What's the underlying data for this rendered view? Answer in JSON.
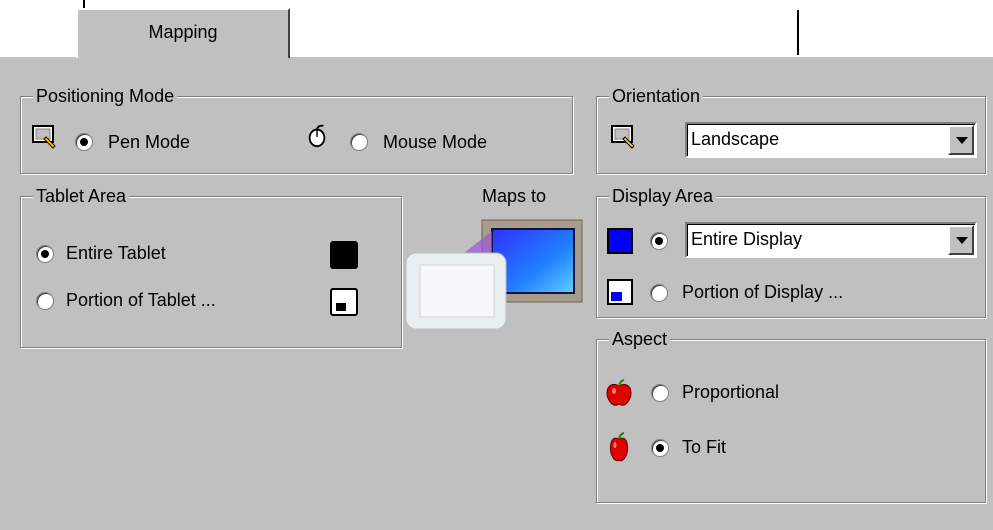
{
  "tabs": [
    {
      "label": "Mapping"
    }
  ],
  "positioning": {
    "title": "Positioning Mode",
    "pen_mode": "Pen Mode",
    "mouse_mode": "Mouse Mode",
    "selected": "pen"
  },
  "orientation": {
    "title": "Orientation",
    "value": "Landscape"
  },
  "tablet_area": {
    "title": "Tablet Area",
    "entire": "Entire Tablet",
    "portion": "Portion of Tablet ...",
    "selected": "entire"
  },
  "maps_to": "Maps to",
  "display_area": {
    "title": "Display Area",
    "value": "Entire Display",
    "portion": "Portion of Display ...",
    "selected": "entire"
  },
  "aspect": {
    "title": "Aspect",
    "proportional": "Proportional",
    "to_fit": "To Fit",
    "selected": "to_fit"
  },
  "colors": {
    "panel_bg": "#c0c0c0",
    "display_blue": "#0000ff",
    "apple_red": "#e00000"
  }
}
